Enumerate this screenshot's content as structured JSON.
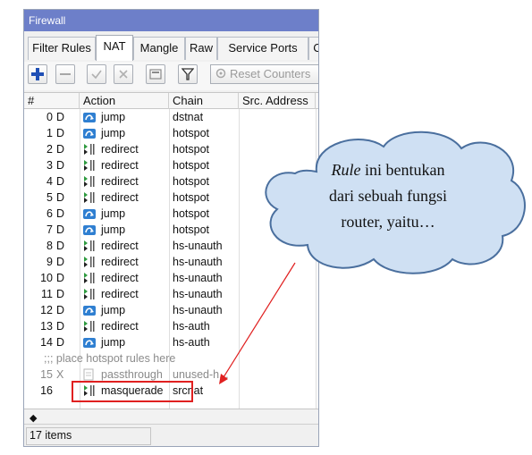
{
  "window": {
    "title": "Firewall"
  },
  "tabs": [
    {
      "label": "Filter Rules",
      "active": false
    },
    {
      "label": "NAT",
      "active": true
    },
    {
      "label": "Mangle",
      "active": false
    },
    {
      "label": "Raw",
      "active": false
    },
    {
      "label": "Service Ports",
      "active": false
    },
    {
      "label": "C",
      "active": false
    }
  ],
  "toolbar": {
    "add_icon": "plus-icon",
    "remove_icon": "minus-icon",
    "enable_icon": "check-icon",
    "disable_icon": "x-icon",
    "comment_icon": "comment-icon",
    "filter_icon": "filter-icon",
    "reset_label": "Reset Counters"
  },
  "grid": {
    "columns": [
      "#",
      "Action",
      "Chain",
      "Src. Address"
    ],
    "rows": [
      {
        "num": "0",
        "flag": "D",
        "action": "jump",
        "chain": "dstnat"
      },
      {
        "num": "1",
        "flag": "D",
        "action": "jump",
        "chain": "hotspot"
      },
      {
        "num": "2",
        "flag": "D",
        "action": "redirect",
        "chain": "hotspot"
      },
      {
        "num": "3",
        "flag": "D",
        "action": "redirect",
        "chain": "hotspot"
      },
      {
        "num": "4",
        "flag": "D",
        "action": "redirect",
        "chain": "hotspot"
      },
      {
        "num": "5",
        "flag": "D",
        "action": "redirect",
        "chain": "hotspot"
      },
      {
        "num": "6",
        "flag": "D",
        "action": "jump",
        "chain": "hotspot"
      },
      {
        "num": "7",
        "flag": "D",
        "action": "jump",
        "chain": "hotspot"
      },
      {
        "num": "8",
        "flag": "D",
        "action": "redirect",
        "chain": "hs-unauth"
      },
      {
        "num": "9",
        "flag": "D",
        "action": "redirect",
        "chain": "hs-unauth"
      },
      {
        "num": "10",
        "flag": "D",
        "action": "redirect",
        "chain": "hs-unauth"
      },
      {
        "num": "11",
        "flag": "D",
        "action": "redirect",
        "chain": "hs-unauth"
      },
      {
        "num": "12",
        "flag": "D",
        "action": "jump",
        "chain": "hs-unauth"
      },
      {
        "num": "13",
        "flag": "D",
        "action": "redirect",
        "chain": "hs-auth"
      },
      {
        "num": "14",
        "flag": "D",
        "action": "jump",
        "chain": "hs-auth"
      }
    ],
    "separator": ";;; place hotspot rules here",
    "disabled_row": {
      "num": "15",
      "flag": "X",
      "action": "passthrough",
      "chain": "unused-h..."
    },
    "last_row": {
      "num": "16",
      "flag": "",
      "action": "masquerade",
      "chain": "srcnat"
    }
  },
  "status": {
    "items": "17 items"
  },
  "callout": {
    "line1_italic": "Rule",
    "line1_rest": " ini bentukan",
    "line2": "dari sebuah fungsi",
    "line3": "router, yaitu…"
  },
  "colors": {
    "titlebar": "#6d7fc9",
    "highlight": "#e02020",
    "jump": "#2f7fd1",
    "redirect": "#2e9a3f"
  }
}
